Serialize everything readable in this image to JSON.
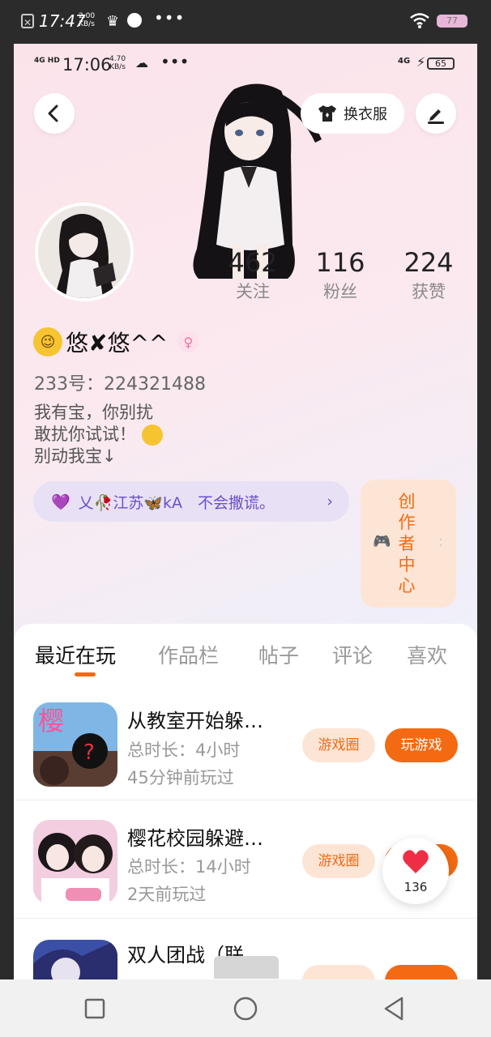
{
  "outer_status": {
    "time": "17:47",
    "speed_top": "2.00",
    "speed_bottom": "KB/s",
    "battery": "77"
  },
  "inner_status": {
    "signal": "4G HD",
    "time": "17:06",
    "speed_top": "4.70",
    "speed_bottom": "KB/s",
    "net": "4G",
    "battery": "65"
  },
  "header": {
    "dress_label": "换衣服"
  },
  "stats": [
    {
      "num": "462",
      "label": "关注"
    },
    {
      "num": "116",
      "label": "粉丝"
    },
    {
      "num": "224",
      "label": "获赞"
    }
  ],
  "profile": {
    "name": "悠✘悠^^",
    "uid": "233号：224321488",
    "bio": [
      "我有宝，你别扰",
      "敢扰你试试！",
      "别动我宝↓"
    ]
  },
  "tag_pill": {
    "text": "乂🥀江苏🦋kA　不会撒谎。"
  },
  "creator": {
    "chars": [
      "创",
      "作",
      "者",
      "中",
      "心"
    ]
  },
  "tabs": [
    "最近在玩",
    "作品栏",
    "帖子",
    "评论",
    "喜欢"
  ],
  "games": [
    {
      "title": "从教室开始躲…",
      "duration": "总时长：4小时",
      "last": "45分钟前玩过",
      "circle": "游戏圈",
      "play": "玩游戏"
    },
    {
      "title": "樱花校园躲避…",
      "duration": "总时长：14小时",
      "last": "2天前玩过",
      "circle": "游戏圈",
      "play": ""
    },
    {
      "title": "双人团战（联…",
      "duration": "",
      "last": "",
      "circle": "",
      "play": ""
    }
  ],
  "thumb_char": "樱",
  "like": {
    "count": "136"
  },
  "colors": {
    "accent": "#f36a12",
    "accent_light": "#fde5d6",
    "pill_bg": "#e8e1f5",
    "like": "#ee2e45"
  }
}
